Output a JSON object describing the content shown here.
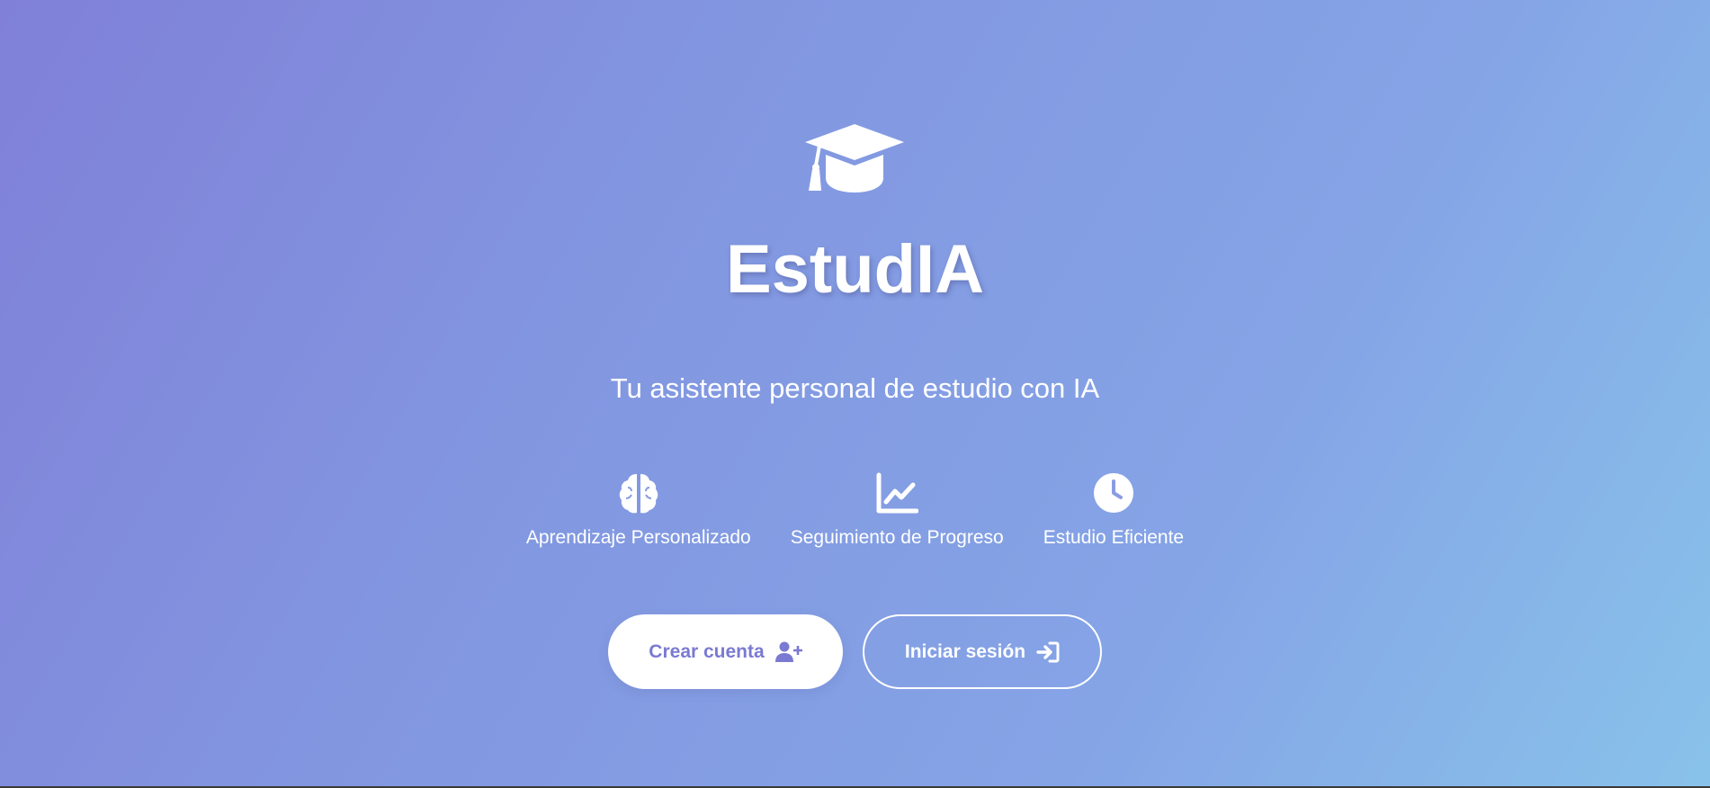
{
  "app": {
    "title": "EstudIA",
    "subtitle": "Tu asistente personal de estudio con IA",
    "logo_icon": "graduation-cap-icon"
  },
  "features": [
    {
      "icon": "brain-icon",
      "label": "Aprendizaje Personalizado"
    },
    {
      "icon": "chart-line-icon",
      "label": "Seguimiento de Progreso"
    },
    {
      "icon": "clock-icon",
      "label": "Estudio Eficiente"
    }
  ],
  "actions": {
    "create_account_label": "Crear cuenta",
    "create_account_icon": "user-plus-icon",
    "login_label": "Iniciar sesión",
    "login_icon": "sign-in-icon"
  },
  "colors": {
    "gradient_start": "#8080d8",
    "gradient_end": "#88c2ea",
    "primary_button_text": "#7a7ad2",
    "text": "#ffffff"
  }
}
